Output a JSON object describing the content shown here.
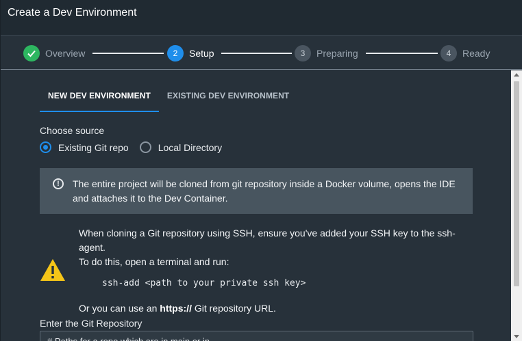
{
  "window": {
    "title": "Create a Dev Environment"
  },
  "stepper": {
    "steps": [
      {
        "number": "",
        "label": "Overview",
        "state": "done"
      },
      {
        "number": "2",
        "label": "Setup",
        "state": "active"
      },
      {
        "number": "3",
        "label": "Preparing",
        "state": "pending"
      },
      {
        "number": "4",
        "label": "Ready",
        "state": "pending"
      }
    ]
  },
  "tabs": [
    {
      "label": "NEW DEV ENVIRONMENT",
      "active": true
    },
    {
      "label": "EXISTING DEV ENVIRONMENT",
      "active": false
    }
  ],
  "source": {
    "label": "Choose source",
    "options": [
      {
        "label": "Existing Git repo",
        "checked": true
      },
      {
        "label": "Local Directory",
        "checked": false
      }
    ]
  },
  "info": {
    "text": "The entire project will be cloned from git repository inside a Docker volume, opens the IDE and attaches it to the Dev Container."
  },
  "ssh": {
    "line1": "When cloning a Git repository using SSH, ensure you've added your SSH key to the ssh-agent.",
    "line2": "To do this, open a terminal and run:",
    "command": "ssh-add <path to your private ssh key>",
    "or_prefix": "Or you can use an ",
    "or_bold": "https://",
    "or_suffix": " Git repository URL."
  },
  "repo": {
    "label": "Enter the Git Repository",
    "placeholder": "# Paths for a repo which are in main or in..."
  },
  "colors": {
    "accent": "#1f8eeb",
    "done": "#2db660",
    "warning": "#f5c518",
    "background": "#27313a"
  }
}
